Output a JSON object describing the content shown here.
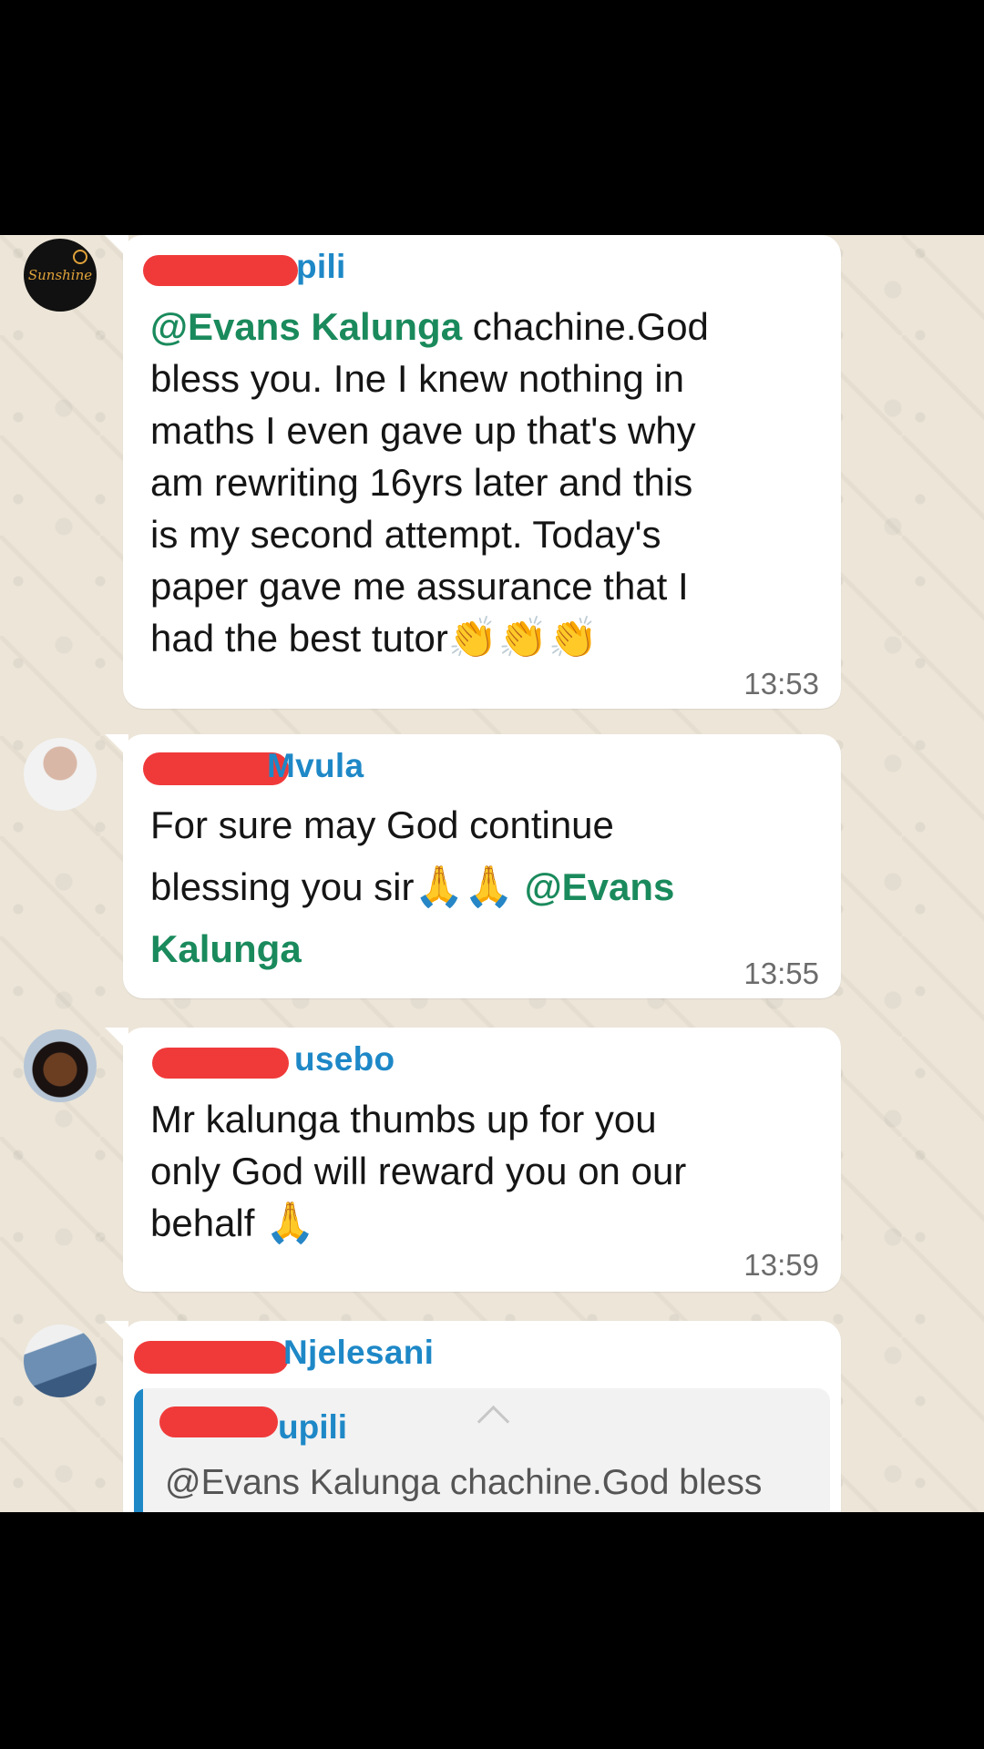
{
  "messages": [
    {
      "sender_suffix": "pili",
      "mention": "@Evans Kalunga",
      "lines": [
        " chachine.God",
        "bless you. Ine I knew nothing in",
        "maths I even gave up that's why",
        "am rewriting 16yrs later and this",
        "is my second attempt. Today's",
        "paper gave me assurance that I",
        "had the best tutor"
      ],
      "emoji": "👏👏👏",
      "time": "13:53"
    },
    {
      "sender_suffix": "Mvula",
      "text_before": "For sure may God continue",
      "text_line2": "blessing you sir",
      "emoji": "🙏🙏",
      "mention": "@Evans",
      "mention_line2": "Kalunga",
      "time": "13:55"
    },
    {
      "sender_suffix": "usebo",
      "lines": [
        "Mr kalunga thumbs up for you",
        "only God will reward you on our",
        "behalf "
      ],
      "emoji": "🙏",
      "time": "13:59"
    },
    {
      "sender_suffix": "Njelesani",
      "quote_sender_suffix": "upili",
      "quote_text": "@Evans Kalunga chachine.God bless"
    }
  ],
  "avatars": [
    "logo-avatar",
    "user-avatar",
    "user-avatar",
    "user-avatar"
  ],
  "avatar_logo_text": "Sunshine"
}
